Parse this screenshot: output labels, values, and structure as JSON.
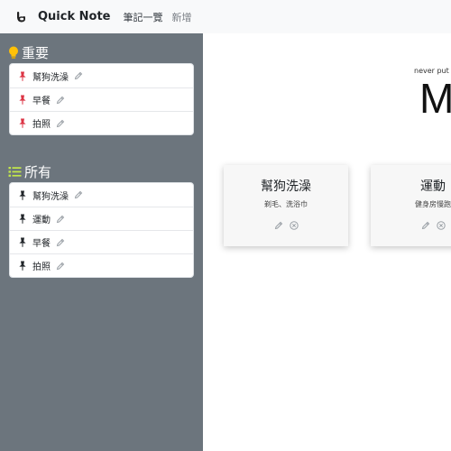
{
  "navbar": {
    "brand_icon": "thumbs-up-hand-icon",
    "brand_text": "Quick Note",
    "links": [
      {
        "label": "筆記一覽",
        "active": true
      },
      {
        "label": "新增",
        "active": false
      }
    ]
  },
  "sidebar": {
    "important": {
      "title": "重要",
      "icon": "lightbulb-icon",
      "items": [
        {
          "label": "幫狗洗澡"
        },
        {
          "label": "早餐"
        },
        {
          "label": "拍照"
        }
      ]
    },
    "all": {
      "title": "所有",
      "icon": "list-icon",
      "items": [
        {
          "label": "幫狗洗澡"
        },
        {
          "label": "運動"
        },
        {
          "label": "早餐"
        },
        {
          "label": "拍照"
        }
      ]
    }
  },
  "main": {
    "tagline": "never put",
    "big_text": "M",
    "cards": [
      {
        "title": "幫狗洗澡",
        "text": "剃毛、洗浴巾"
      },
      {
        "title": "運動",
        "text": "健身房慢跑"
      }
    ]
  },
  "colors": {
    "sidebar_bg": "#6c757d",
    "navbar_bg": "#f8f9fa",
    "pin_important": "#dc3545",
    "pin_normal": "#212529",
    "lightbulb": "#ffc107",
    "list_icon": "#c3e84a",
    "action_icon": "#9aa0a6"
  }
}
